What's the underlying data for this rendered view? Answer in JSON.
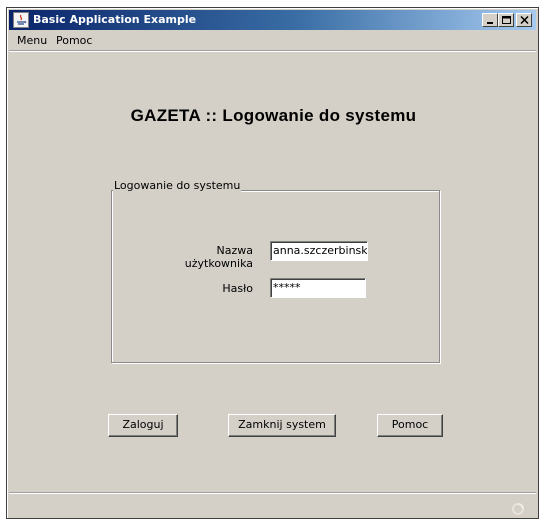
{
  "window": {
    "title": "Basic Application Example",
    "controls": [
      "minimize-icon",
      "maximize-icon",
      "close-icon"
    ]
  },
  "menubar": {
    "items": [
      {
        "label": "Menu"
      },
      {
        "label": "Pomoc"
      }
    ]
  },
  "header": {
    "title": "GAZETA :: Logowanie do systemu"
  },
  "login_panel": {
    "legend": "Logowanie do systemu",
    "username_label": "Nazwa użytkownika",
    "username_value": "anna.szczerbinska",
    "password_label": "Hasło",
    "password_value": "*****"
  },
  "actions": {
    "login": "Zaloguj",
    "shutdown": "Zamknij system",
    "help": "Pomoc"
  },
  "status": {
    "icon": "busy-indicator-icon"
  }
}
